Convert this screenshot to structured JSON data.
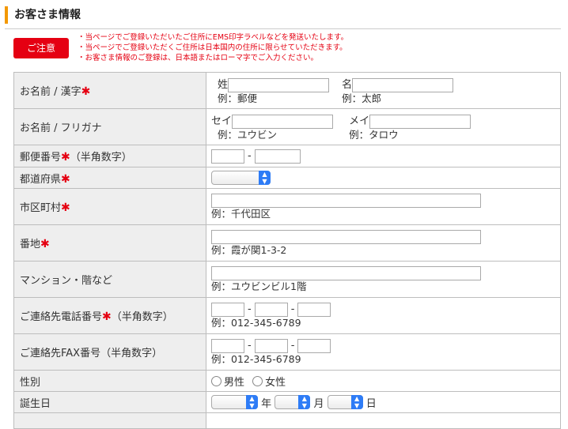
{
  "section_title": "お客さま情報",
  "notice": {
    "button_label": "ご注意",
    "lines": [
      "・当ページでご登録いただいたご住所にEMS印字ラベルなどを発送いたします。",
      "・当ページでご登録いただくご住所は日本国内の住所に限らせていただきます。",
      "・お客さま情報のご登録は、日本語またはローマ字でご入力ください。"
    ]
  },
  "form": {
    "name_kanji": {
      "label": "お名前 / 漢字",
      "required_mark": "✱",
      "last_label": "姓",
      "first_label": "名",
      "last_hint": "例：郵便",
      "first_hint": "例：太郎"
    },
    "name_kana": {
      "label": "お名前 / フリガナ",
      "last_label": "セイ",
      "first_label": "メイ",
      "last_hint": "例：ユウビン",
      "first_hint": "例：タロウ"
    },
    "postal": {
      "label": "郵便番号",
      "required_mark": "✱",
      "note": "（半角数字）",
      "separator": "-"
    },
    "prefecture": {
      "label": "都道府県",
      "required_mark": "✱"
    },
    "city": {
      "label": "市区町村",
      "required_mark": "✱",
      "hint": "例：千代田区"
    },
    "address": {
      "label": "番地",
      "required_mark": "✱",
      "hint": "例：霞が関1-3-2"
    },
    "building": {
      "label": "マンション・階など",
      "hint": "例：ユウビンビル1階"
    },
    "phone": {
      "label": "ご連絡先電話番号",
      "required_mark": "✱",
      "note": "（半角数字）",
      "separator": "-",
      "hint": "例：012-345-6789"
    },
    "fax": {
      "label": "ご連絡先FAX番号（半角数字）",
      "separator": "-",
      "hint": "例：012-345-6789"
    },
    "gender": {
      "label": "性別",
      "options": [
        "男性",
        "女性"
      ]
    },
    "birthday": {
      "label": "誕生日",
      "year_unit": "年",
      "month_unit": "月",
      "day_unit": "日"
    }
  },
  "colors": {
    "accent_orange": "#f39800",
    "required_red": "#e50012",
    "label_bg": "#eeeeee",
    "select_blue": "#2e7cf6"
  }
}
